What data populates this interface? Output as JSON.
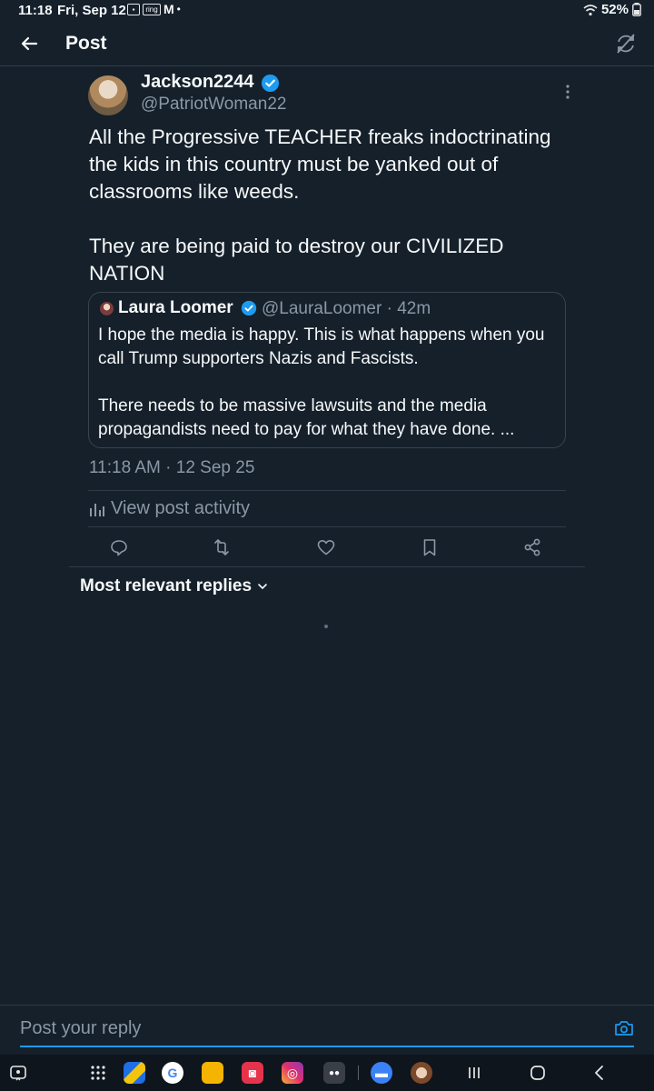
{
  "status_bar": {
    "time": "11:18",
    "date": "Fri, Sep 12",
    "notif_icons": [
      "calendar-icon",
      "ring-icon",
      "gmail-icon"
    ],
    "ring_text": "ring",
    "dot": "•",
    "battery": "52%"
  },
  "header": {
    "title": "Post"
  },
  "post": {
    "author_name": "Jackson2244",
    "handle": "@PatriotWoman22",
    "body": "All the Progressive TEACHER freaks indoctrinating the kids in this country must be yanked out of classrooms like weeds.\n\nThey are being paid to destroy our CIVILIZED NATION",
    "quote": {
      "author_name": "Laura Loomer",
      "handle_time": "@LauraLoomer · 42m",
      "text": "I hope the media is happy. This is what happens when you call Trump supporters Nazis and Fascists.\n\nThere needs to be massive lawsuits and the media propagandists need to pay for what they have done. ..."
    },
    "timestamp": "11:18 AM · 12 Sep 25",
    "activity_label": "View post activity"
  },
  "replies": {
    "sort_label": "Most relevant replies"
  },
  "reply_bar": {
    "placeholder": "Post your reply"
  },
  "colors": {
    "background": "#15202b",
    "accent": "#1d9bf0",
    "secondary_text": "#8b98a5",
    "divider": "#2f3b47"
  }
}
